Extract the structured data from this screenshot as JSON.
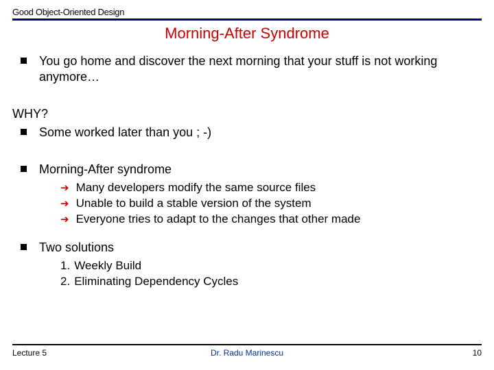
{
  "header": {
    "label": "Good Object-Oriented Design"
  },
  "title": "Morning-After Syndrome",
  "bullets": {
    "b1": "You go home and discover the next morning that your stuff is not working anymore…",
    "why": "WHY?",
    "b2": "Some worked later than you ; -)",
    "b3": "Morning-After syndrome",
    "b3_sub": [
      "Many developers modify the same source files",
      "Unable to build a stable version of the system",
      "Everyone tries to adapt to the changes that other made"
    ],
    "b4": "Two solutions",
    "b4_sub": [
      {
        "n": "1.",
        "t": "Weekly Build"
      },
      {
        "n": "2.",
        "t": "Eliminating Dependency Cycles"
      }
    ]
  },
  "footer": {
    "left": "Lecture 5",
    "center": "Dr. Radu Marinescu",
    "right": "10"
  }
}
